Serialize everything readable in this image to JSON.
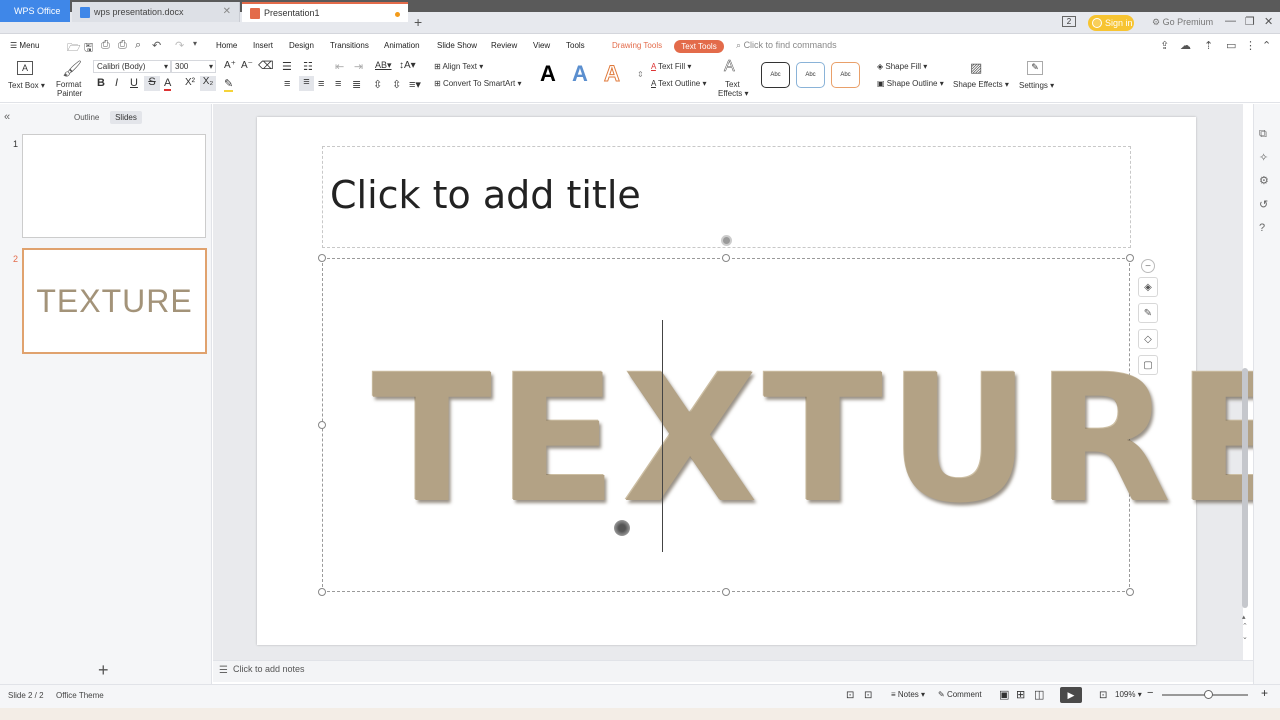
{
  "tabs": {
    "wps_office": "WPS Office",
    "document": "wps presentation.docx",
    "presentation": "Presentation1",
    "add": "+"
  },
  "header": {
    "signin": "Sign in",
    "premium": "Go Premium",
    "box_num": "2"
  },
  "menu": {
    "menu_label": "Menu",
    "items": [
      "Home",
      "Insert",
      "Design",
      "Transitions",
      "Animation",
      "Slide Show",
      "Review",
      "View",
      "Tools"
    ],
    "drawing_tools": "Drawing Tools",
    "text_tools": "Text Tools",
    "find_placeholder": "Click to find commands"
  },
  "ribbon": {
    "text_box": "Text Box",
    "format_painter_1": "Format",
    "format_painter_2": "Painter",
    "font_name": "Calibri (Body)",
    "font_size": "300",
    "align_text": "Align Text",
    "convert_smartart": "Convert To SmartArt",
    "text_fill": "Text Fill",
    "text_outline": "Text Outline",
    "text_effects_1": "Text",
    "text_effects_2": "Effects",
    "style_sample": "Abc",
    "shape_fill": "Shape Fill",
    "shape_outline": "Shape Outline",
    "shape_effects": "Shape Effects",
    "settings": "Settings",
    "letter_a": "A"
  },
  "leftpanel": {
    "outline": "Outline",
    "slides": "Slides",
    "thumb1_num": "1",
    "thumb2_num": "2",
    "thumb2_text": "TEXTURE"
  },
  "slide": {
    "title_placeholder": "Click to add title",
    "body_text": "TEXTURE"
  },
  "notes": {
    "placeholder": "Click to add notes"
  },
  "status": {
    "slide": "Slide 2 / 2",
    "theme": "Office Theme",
    "notes": "Notes",
    "comment": "Comment",
    "zoom": "109%"
  },
  "colors": {
    "accent": "#e36b4a",
    "wps_blue": "#3f87e8",
    "signin": "#f7c431",
    "texture": "#b3a285"
  }
}
